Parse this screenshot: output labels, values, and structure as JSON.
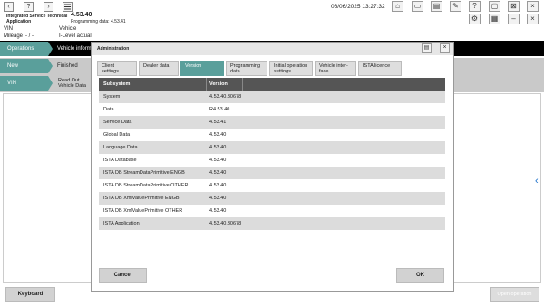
{
  "app": {
    "title_line1": "Integrated Service Technical",
    "title_line2": "Application",
    "version": "4.53.40",
    "prog_label": "Programming data:",
    "prog_value": "4.53.41",
    "datetime": "06/06/2025 13:27:32"
  },
  "toolbar": {
    "back": "‹",
    "help": "?",
    "forward": "›"
  },
  "info": {
    "vin_label": "VIN",
    "mileage_label": "Mileage",
    "mileage_value": "- / -",
    "vehicle_label": "Vehicle",
    "ilevel_label": "I-Level actual"
  },
  "nav": {
    "operations": "Operations",
    "vehicle_info": "Vehicle inform",
    "new": "New",
    "finished": "Finished",
    "vin": "VIN",
    "read_out_1": "Read Out",
    "read_out_2": "Vehicle Data"
  },
  "footer": {
    "keyboard": "Keyboard",
    "open_operation": "Open operation"
  },
  "dialog": {
    "title": "Administration",
    "tabs": [
      {
        "l1": "Client settings",
        "l2": ""
      },
      {
        "l1": "Dealer data",
        "l2": ""
      },
      {
        "l1": "Version",
        "l2": ""
      },
      {
        "l1": "Programming",
        "l2": "data"
      },
      {
        "l1": "Initial operation",
        "l2": "settings"
      },
      {
        "l1": "Vehicle inter-",
        "l2": "face"
      },
      {
        "l1": "ISTA licence",
        "l2": ""
      }
    ],
    "columns": {
      "subsystem": "Subsystem",
      "version": "Version"
    },
    "rows": [
      {
        "subsystem": "System",
        "version": "4.53.40.30678"
      },
      {
        "subsystem": "Data",
        "version": "R4.53.40"
      },
      {
        "subsystem": "Service Data",
        "version": "4.53.41"
      },
      {
        "subsystem": "Global Data",
        "version": "4.53.40"
      },
      {
        "subsystem": "Language Data",
        "version": "4.53.40"
      },
      {
        "subsystem": "ISTA Database",
        "version": "4.53.40"
      },
      {
        "subsystem": "ISTA DB StreamDataPrimitive ENGB",
        "version": "4.53.40"
      },
      {
        "subsystem": "ISTA DB StreamDataPrimitive OTHER",
        "version": "4.53.40"
      },
      {
        "subsystem": "ISTA DB XmlValuePrimitive ENGB",
        "version": "4.53.40"
      },
      {
        "subsystem": "ISTA DB XmlValuePrimitive OTHER",
        "version": "4.53.40"
      },
      {
        "subsystem": "ISTA Application",
        "version": "4.53.40.30678"
      }
    ],
    "cancel": "Cancel",
    "ok": "OK"
  },
  "colors": {
    "accent": "#5a9f9b",
    "header": "#5c5c5c",
    "black_bar": "#000000"
  },
  "icons": [
    "back-icon",
    "help-icon",
    "forward-icon",
    "list-icon",
    "home-icon",
    "screen-icon",
    "print-icon",
    "tool-icon",
    "question-icon",
    "window-icon",
    "window-close-icon",
    "gear-icon",
    "grid-icon",
    "minimize-icon",
    "close-icon",
    "chevron-left-icon"
  ]
}
